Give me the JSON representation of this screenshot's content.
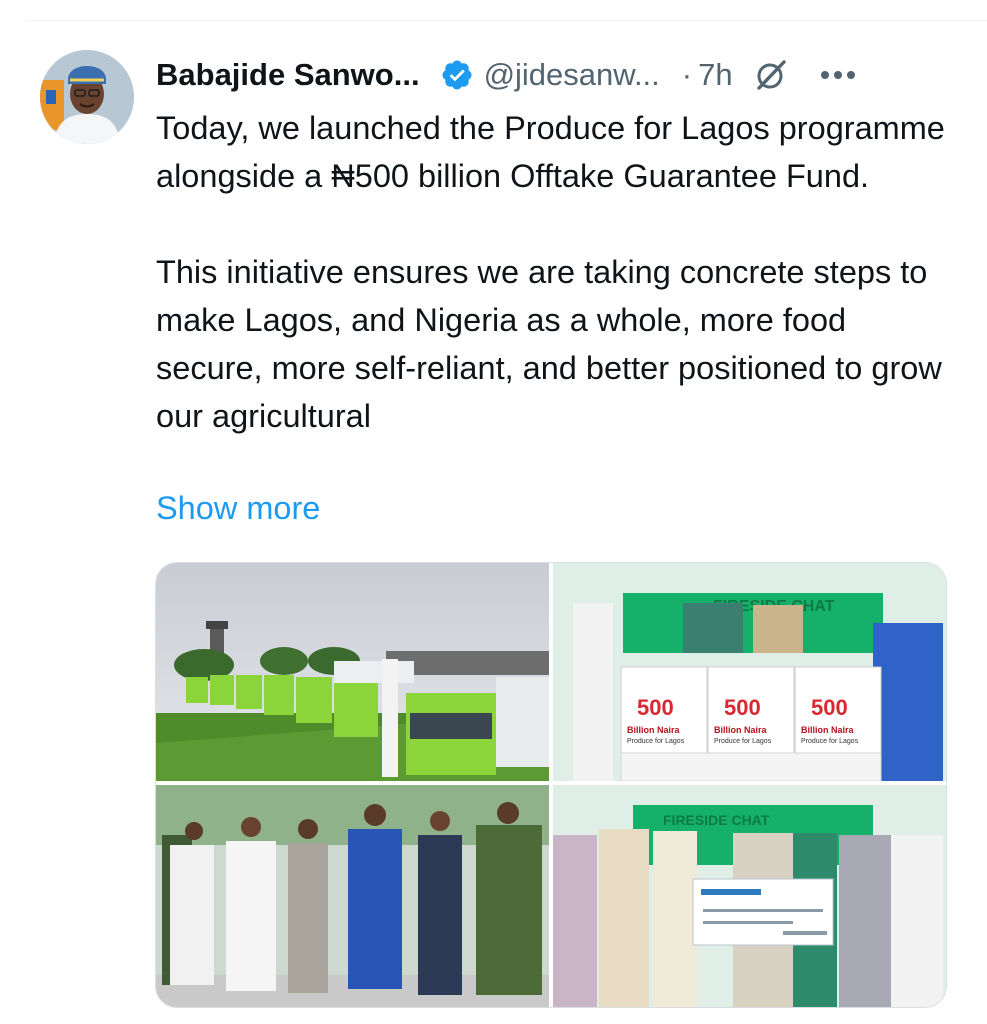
{
  "tweet": {
    "author_name": "Babajide Sanwo...",
    "handle": "@jidesanw...",
    "separator": "·",
    "time": "7h",
    "paragraph_1": "Today, we launched the Produce for Lagos programme alongside a ₦500 billion Offtake Guarantee Fund.",
    "paragraph_2": "This initiative ensures we are taking concrete steps to make Lagos, and Nigeria as a whole, more food secure, more self-reliant, and better positioned to grow our agricultural",
    "show_more": "Show more"
  },
  "media": {
    "photo_2": {
      "banner": "FIRESIDE CHAT",
      "box_label_number": "500",
      "box_label_line1": "Billion Naira",
      "box_label_line2": "Produce for Lagos"
    },
    "photo_4": {
      "banner": "FIRESIDE CHAT"
    }
  },
  "icons": {
    "verified": "verified-badge-icon",
    "grok": "grok-icon",
    "more": "more-options-icon"
  },
  "colors": {
    "text_primary": "#0f1419",
    "text_secondary": "#536471",
    "accent_blue": "#1d9bf0",
    "truck_green": "#8bd43a"
  }
}
